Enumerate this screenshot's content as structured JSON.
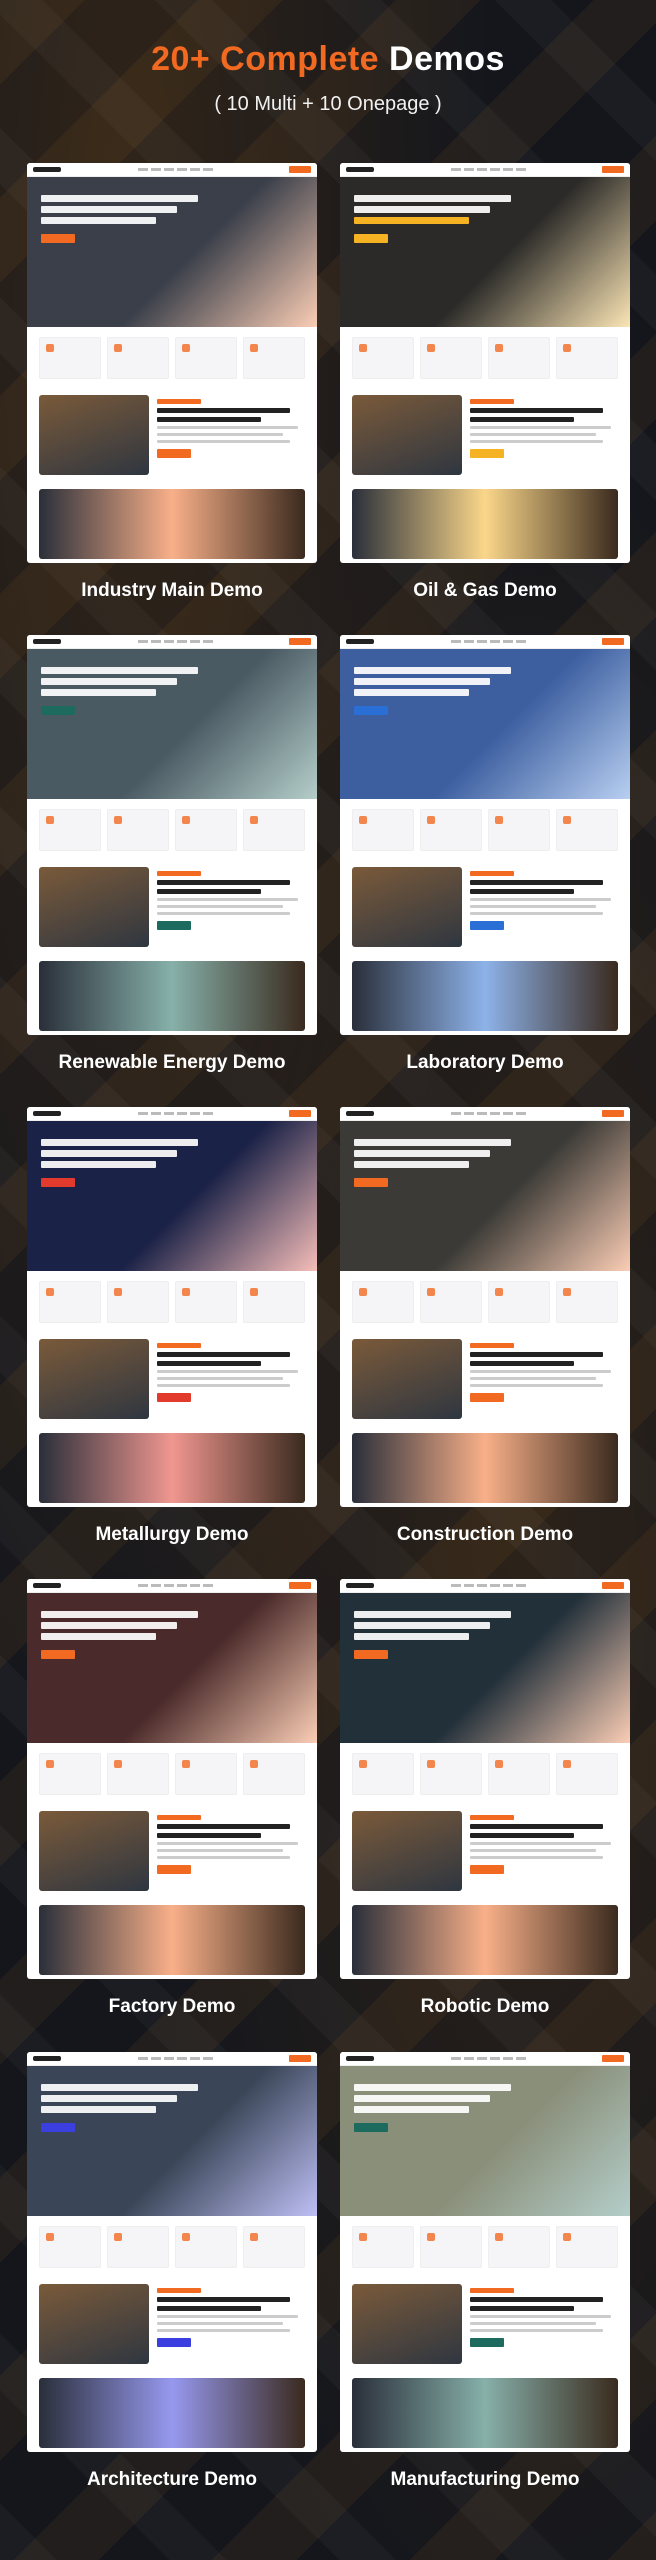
{
  "header": {
    "title_accent": "20+ Complete",
    "title_rest": "Demos",
    "subtitle": "( 10 Multi + 10 Onepage )"
  },
  "demos": [
    {
      "label": "Industry Main Demo",
      "hero_color": "#3a3f4a",
      "accent": "#f26a21",
      "hero_text": "Moving Your Industry Manufacturing Forward"
    },
    {
      "label": "Oil & Gas Demo",
      "hero_color": "#2b2a28",
      "accent": "#f5b323",
      "hero_text": "WE'RE IN BUSINESS TO MAKE INDUSTRIAL GAS FACTORY"
    },
    {
      "label": "Renewable Energy Demo",
      "hero_color": "#4a5a63",
      "accent": "#1d6b5e",
      "hero_text": "Renewable Energy"
    },
    {
      "label": "Laboratory Demo",
      "hero_color": "#3d5fa0",
      "accent": "#2a6fd6",
      "hero_text": "Reliable Laboratory"
    },
    {
      "label": "Metallurgy Demo",
      "hero_color": "#1b2247",
      "accent": "#e23b2e",
      "hero_text": "Innovations In Metallurgy Solutions"
    },
    {
      "label": "Construction Demo",
      "hero_color": "#3b3a36",
      "accent": "#f26a21",
      "hero_text": "Quality Construction Building Service"
    },
    {
      "label": "Factory Demo",
      "hero_color": "#4a2a2a",
      "accent": "#f26a21",
      "hero_text": "Factory Industrial Production Around The World"
    },
    {
      "label": "Robotic Demo",
      "hero_color": "#22303a",
      "accent": "#f26a21",
      "hero_text": "The robotization of our world is an great advantage"
    },
    {
      "label": "Architecture Demo",
      "hero_color": "#3a4658",
      "accent": "#3b3fe0",
      "hero_text": "We're In Business To Make Industrial Factory"
    },
    {
      "label": "Manufacturing Demo",
      "hero_color": "#8a8f7a",
      "accent": "#1d6b5e",
      "hero_text": "Manufacture"
    }
  ]
}
